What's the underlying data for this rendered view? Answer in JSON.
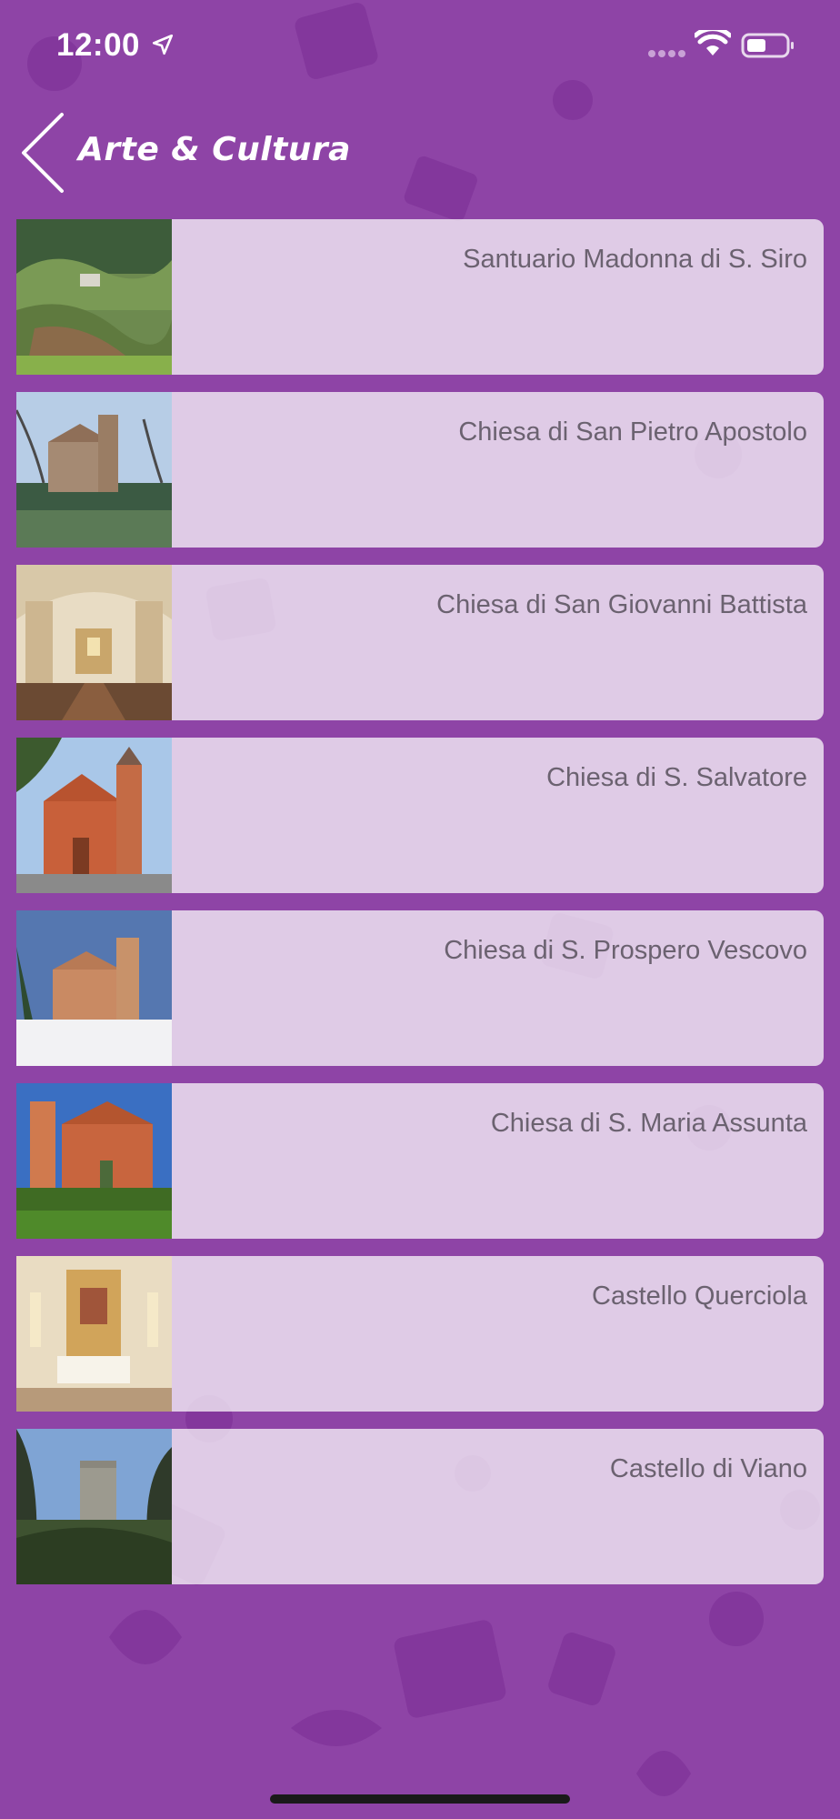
{
  "status_bar": {
    "time": "12:00",
    "icons": [
      "location-arrow-icon",
      "cellular-signal-icon",
      "wifi-icon",
      "battery-icon"
    ]
  },
  "nav": {
    "back_icon": "chevron-left-icon",
    "title": "Arte & Cultura"
  },
  "colors": {
    "background": "#8e44a6",
    "pattern": "#7f3399",
    "card": "#e6d4ec",
    "label": "#6b6270"
  },
  "items": [
    {
      "label": "Santuario Madonna di S. Siro",
      "thumb": "landscape-photo"
    },
    {
      "label": "Chiesa di San Pietro Apostolo",
      "thumb": "church-photo"
    },
    {
      "label": "Chiesa di San Giovanni Battista",
      "thumb": "church-interior-photo"
    },
    {
      "label": "Chiesa di S. Salvatore",
      "thumb": "church-photo"
    },
    {
      "label": "Chiesa di S. Prospero Vescovo",
      "thumb": "church-snow-photo"
    },
    {
      "label": "Chiesa di S. Maria Assunta",
      "thumb": "church-photo"
    },
    {
      "label": "Castello Querciola",
      "thumb": "altar-interior-photo"
    },
    {
      "label": "Castello di Viano",
      "thumb": "castle-tower-photo"
    }
  ]
}
